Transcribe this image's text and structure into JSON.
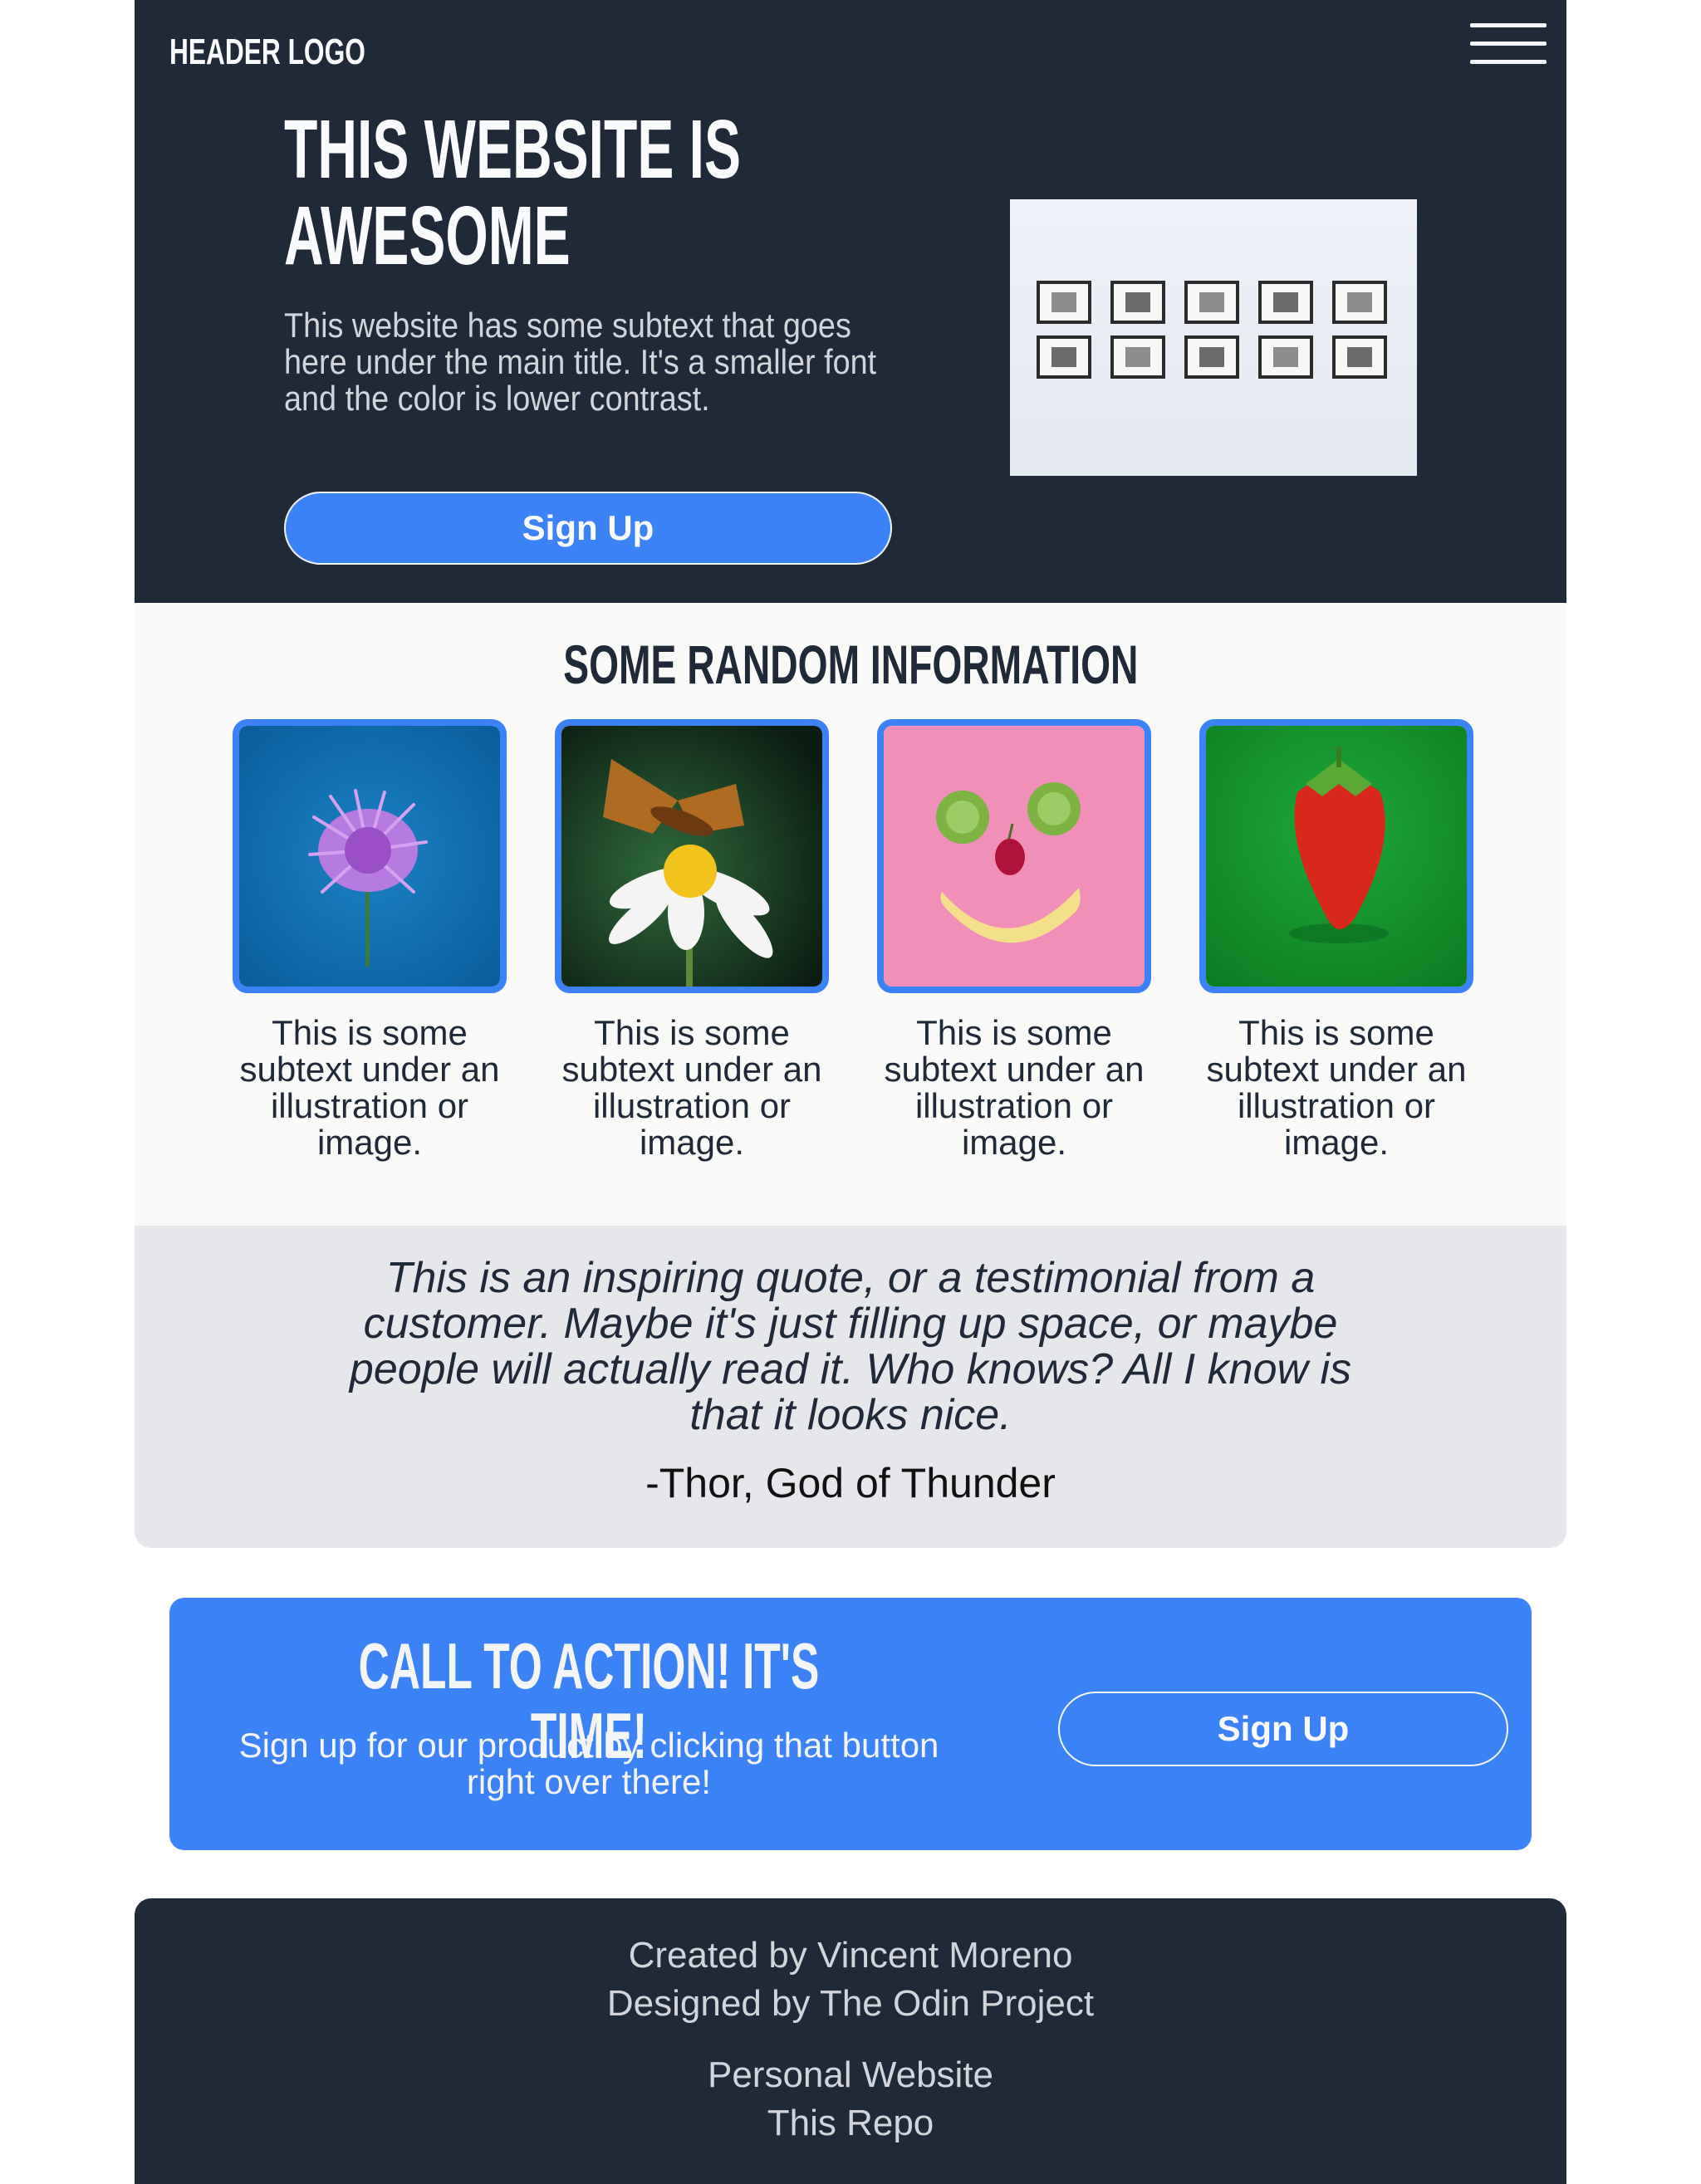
{
  "header": {
    "logo": "HEADER LOGO",
    "menu_icon": "hamburger-menu-icon"
  },
  "hero": {
    "title_line1": "THIS WEBSITE IS",
    "title_line2": "AWESOME",
    "subtext": "This website has some subtext that goes here under the main title. It's a smaller font and the color is lower contrast.",
    "button_label": "Sign Up",
    "image_description": "gallery-wall-of-framed-photos"
  },
  "info": {
    "title": "SOME RANDOM INFORMATION",
    "cards": [
      {
        "image": "purple-flower-photo",
        "text": "This is some subtext under an illustration or image."
      },
      {
        "image": "butterfly-on-daisy-photo",
        "text": "This is some subtext under an illustration or image."
      },
      {
        "image": "fruit-smiley-face-photo",
        "text": "This is some subtext under an illustration or image."
      },
      {
        "image": "strawberry-photo",
        "text": "This is some subtext under an illustration or image."
      }
    ]
  },
  "quote": {
    "text": "This is an inspiring quote, or a testimonial from a customer. Maybe it's just filling up space, or maybe people will actually read it. Who knows? All I know is that it looks nice.",
    "author": "-Thor, God of Thunder"
  },
  "cta": {
    "title": "CALL TO ACTION! IT'S TIME!",
    "subtext": "Sign up for our product by clicking that button right over there!",
    "button_label": "Sign Up"
  },
  "footer": {
    "created_by": "Created by Vincent Moreno",
    "designed_by": "Designed by The Odin Project",
    "link_personal": "Personal Website",
    "link_repo": "This Repo"
  },
  "colors": {
    "dark": "#1f2937",
    "accent": "#3b82f6",
    "light_bg": "#f9f9f7",
    "quote_bg": "#e5e7eb"
  }
}
